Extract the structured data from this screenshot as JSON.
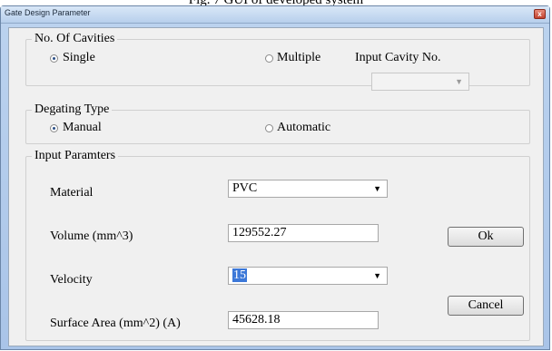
{
  "caption": "Fig. 7 GUI of developed system",
  "window": {
    "title": "Gate Design Parameter",
    "close_glyph": "x"
  },
  "cavities": {
    "legend": "No. Of Cavities",
    "single_label": "Single",
    "multiple_label": "Multiple",
    "selected": "single",
    "input_cavity_label": "Input Cavity No.",
    "input_cavity_value": ""
  },
  "degating": {
    "legend": "Degating Type",
    "manual_label": "Manual",
    "automatic_label": "Automatic",
    "selected": "manual"
  },
  "params": {
    "legend": "Input Paramters",
    "material_label": "Material",
    "material_value": "PVC",
    "volume_label": "Volume (mm^3)",
    "volume_value": "129552.27",
    "velocity_label": "Velocity",
    "velocity_value": "15",
    "surface_label": "Surface Area (mm^2) (A)",
    "surface_value": "45628.18"
  },
  "buttons": {
    "ok": "Ok",
    "cancel": "Cancel"
  }
}
